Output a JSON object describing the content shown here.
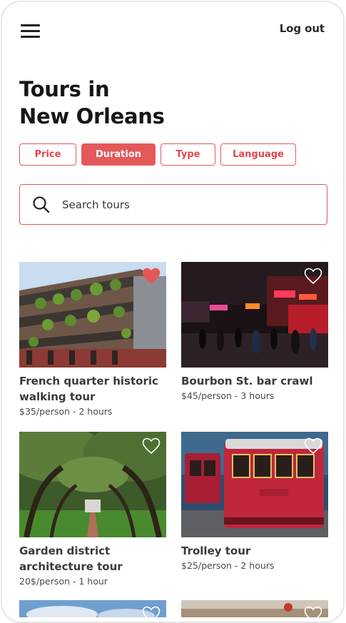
{
  "header": {
    "logout_label": "Log out"
  },
  "page": {
    "title_line1": "Tours in",
    "title_line2": "New Orleans"
  },
  "filters": [
    {
      "label": "Price",
      "active": false
    },
    {
      "label": "Duration",
      "active": true
    },
    {
      "label": "Type",
      "active": false
    },
    {
      "label": "Language",
      "active": false
    }
  ],
  "search": {
    "placeholder": "Search tours",
    "value": ""
  },
  "tours": [
    {
      "title": "French quarter historic walking tour",
      "details": "$35/person - 2 hours",
      "favorited": true
    },
    {
      "title": "Bourbon St. bar crawl",
      "details": "$45/person - 3 hours",
      "favorited": false
    },
    {
      "title": "Garden district architecture tour",
      "details": "20$/person - 1 hour",
      "favorited": false
    },
    {
      "title": "Trolley tour",
      "details": "$25/person - 2 hours",
      "favorited": false
    }
  ],
  "colors": {
    "accent": "#e5585a",
    "text": "#1a1a1a"
  },
  "icons": {
    "menu": "hamburger-menu-icon",
    "search": "magnifier-icon",
    "favorite": "heart-icon"
  }
}
